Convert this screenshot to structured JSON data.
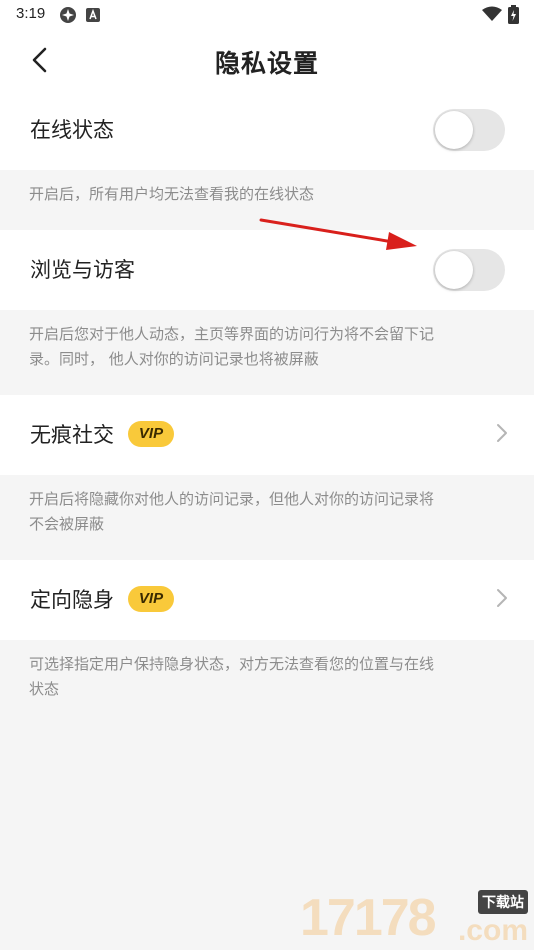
{
  "status_bar": {
    "time": "3:19",
    "icons": [
      "settings-icon",
      "a-icon",
      "wifi-icon",
      "battery-charging-icon"
    ]
  },
  "nav": {
    "title": "隐私设置",
    "back_icon": "chevron-left-icon"
  },
  "settings": [
    {
      "label": "在线状态",
      "control": "toggle",
      "enabled": false,
      "description": "开启后，所有用户均无法查看我的在线状态"
    },
    {
      "label": "浏览与访客",
      "control": "toggle",
      "enabled": false,
      "description_lines": [
        "开启后您对于他人动态，主页等界面的访问行为将不会留下记",
        "录。同时， 他人对你的访问记录也将被屏蔽"
      ]
    },
    {
      "label": "无痕社交",
      "badge": "VIP",
      "control": "chevron",
      "description_lines": [
        "开启后将隐藏你对他人的访问记录，但他人对你的访问记录将",
        "不会被屏蔽"
      ]
    },
    {
      "label": "定向隐身",
      "badge": "VIP",
      "control": "chevron",
      "description_lines": [
        "可选择指定用户保持隐身状态，对方无法查看您的位置与在线",
        "状态"
      ]
    }
  ],
  "colors": {
    "background": "#f5f5f5",
    "vip_badge": "#f9c93a",
    "toggle_off": "#e6e6e6",
    "annotation_arrow": "#d9201c"
  },
  "watermark": {
    "digits": "17178",
    "tag": "下载站",
    "suffix": ".com"
  }
}
